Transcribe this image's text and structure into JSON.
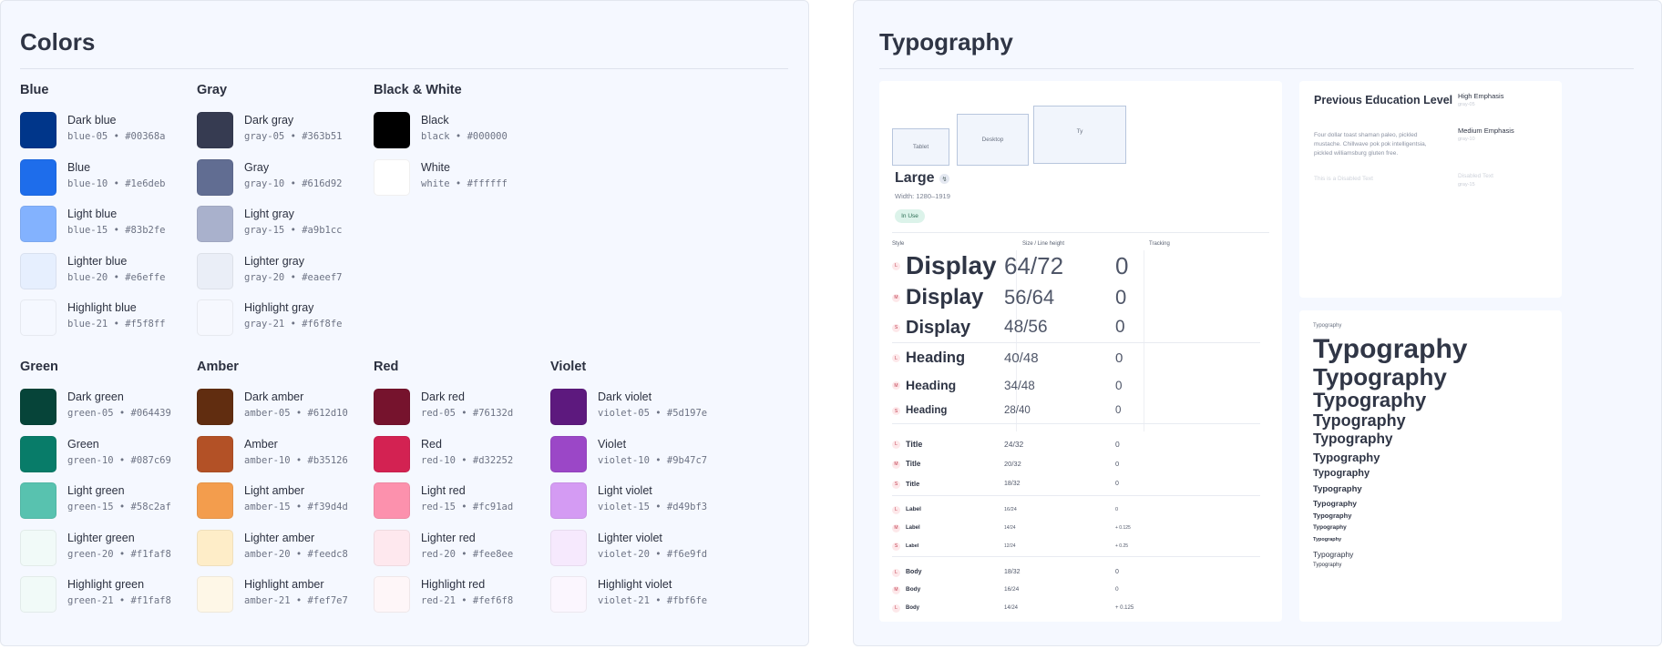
{
  "colors": {
    "title": "Colors",
    "groups": [
      {
        "name": "Blue",
        "swatches": [
          {
            "name": "Dark blue",
            "token": "blue-05",
            "hex": "#00368a"
          },
          {
            "name": "Blue",
            "token": "blue-10",
            "hex": "#1e6deb"
          },
          {
            "name": "Light blue",
            "token": "blue-15",
            "hex": "#83b2fe"
          },
          {
            "name": "Lighter blue",
            "token": "blue-20",
            "hex": "#e6effe"
          },
          {
            "name": "Highlight blue",
            "token": "blue-21",
            "hex": "#f5f8ff"
          }
        ]
      },
      {
        "name": "Gray",
        "swatches": [
          {
            "name": "Dark gray",
            "token": "gray-05",
            "hex": "#363b51"
          },
          {
            "name": "Gray",
            "token": "gray-10",
            "hex": "#616d92"
          },
          {
            "name": "Light gray",
            "token": "gray-15",
            "hex": "#a9b1cc"
          },
          {
            "name": "Lighter gray",
            "token": "gray-20",
            "hex": "#eaeef7"
          },
          {
            "name": "Highlight gray",
            "token": "gray-21",
            "hex": "#f6f8fe"
          }
        ]
      },
      {
        "name": "Black & White",
        "swatches": [
          {
            "name": "Black",
            "token": "black",
            "hex": "#000000"
          },
          {
            "name": "White",
            "token": "white",
            "hex": "#ffffff"
          }
        ]
      },
      {
        "name": "Green",
        "swatches": [
          {
            "name": "Dark green",
            "token": "green-05",
            "hex": "#064439"
          },
          {
            "name": "Green",
            "token": "green-10",
            "hex": "#087c69"
          },
          {
            "name": "Light green",
            "token": "green-15",
            "hex": "#58c2af"
          },
          {
            "name": "Lighter green",
            "token": "green-20",
            "hex": "#f1faf8"
          },
          {
            "name": "Highlight green",
            "token": "green-21",
            "hex": "#f1faf8"
          }
        ]
      },
      {
        "name": "Amber",
        "swatches": [
          {
            "name": "Dark amber",
            "token": "amber-05",
            "hex": "#612d10"
          },
          {
            "name": "Amber",
            "token": "amber-10",
            "hex": "#b35126"
          },
          {
            "name": "Light amber",
            "token": "amber-15",
            "hex": "#f39d4d"
          },
          {
            "name": "Lighter amber",
            "token": "amber-20",
            "hex": "#feedc8"
          },
          {
            "name": "Highlight amber",
            "token": "amber-21",
            "hex": "#fef7e7"
          }
        ]
      },
      {
        "name": "Red",
        "swatches": [
          {
            "name": "Dark red",
            "token": "red-05",
            "hex": "#76132d"
          },
          {
            "name": "Red",
            "token": "red-10",
            "hex": "#d32252"
          },
          {
            "name": "Light red",
            "token": "red-15",
            "hex": "#fc91ad"
          },
          {
            "name": "Lighter red",
            "token": "red-20",
            "hex": "#fee8ee"
          },
          {
            "name": "Highlight red",
            "token": "red-21",
            "hex": "#fef6f8"
          }
        ]
      },
      {
        "name": "Violet",
        "swatches": [
          {
            "name": "Dark violet",
            "token": "violet-05",
            "hex": "#5d197e"
          },
          {
            "name": "Violet",
            "token": "violet-10",
            "hex": "#9b47c7"
          },
          {
            "name": "Light violet",
            "token": "violet-15",
            "hex": "#d49bf3"
          },
          {
            "name": "Lighter violet",
            "token": "violet-20",
            "hex": "#f6e9fd"
          },
          {
            "name": "Highlight violet",
            "token": "violet-21",
            "hex": "#fbf6fe"
          }
        ]
      }
    ]
  },
  "typography": {
    "title": "Typography",
    "breakpoints": [
      "Tablet",
      "Desktop",
      "Ty"
    ],
    "large": {
      "title": "Large",
      "pin": "↯",
      "width": "Width: 1280–1919",
      "badge": "In Use"
    },
    "table": {
      "headers": [
        "Style",
        "Size / Line height",
        "Tracking"
      ],
      "rows": [
        {
          "size_tag": "L",
          "style": "Display",
          "size": "64/72",
          "tracking": "0"
        },
        {
          "size_tag": "M",
          "style": "Display",
          "size": "56/64",
          "tracking": "0"
        },
        {
          "size_tag": "S",
          "style": "Display",
          "size": "48/56",
          "tracking": "0"
        },
        {
          "size_tag": "L",
          "style": "Heading",
          "size": "40/48",
          "tracking": "0"
        },
        {
          "size_tag": "M",
          "style": "Heading",
          "size": "34/48",
          "tracking": "0"
        },
        {
          "size_tag": "S",
          "style": "Heading",
          "size": "28/40",
          "tracking": "0"
        },
        {
          "size_tag": "L",
          "style": "Title",
          "size": "24/32",
          "tracking": "0"
        },
        {
          "size_tag": "M",
          "style": "Title",
          "size": "20/32",
          "tracking": "0"
        },
        {
          "size_tag": "S",
          "style": "Title",
          "size": "18/32",
          "tracking": "0"
        },
        {
          "size_tag": "L",
          "style": "Label",
          "size": "16/24",
          "tracking": "0"
        },
        {
          "size_tag": "M",
          "style": "Label",
          "size": "14/24",
          "tracking": "+ 0.125"
        },
        {
          "size_tag": "S",
          "style": "Label",
          "size": "12/24",
          "tracking": "+ 0.25"
        },
        {
          "size_tag": "L",
          "style": "Body",
          "size": "18/32",
          "tracking": "0"
        },
        {
          "size_tag": "M",
          "style": "Body",
          "size": "16/24",
          "tracking": "0"
        },
        {
          "size_tag": "L",
          "style": "Body",
          "size": "14/24",
          "tracking": "+ 0.125"
        }
      ]
    },
    "education": {
      "title": "Previous Education Level",
      "body": "Four dollar toast shaman paleo, pickled mustache. Chillwave pok pok intelligentsia, pickled williamsburg gluten free.",
      "disabled": "This is a Disabled Text",
      "high_emphasis": "High Emphasis",
      "high_emphasis_sub": "gray-05",
      "medium_emphasis": "Medium  Emphasis",
      "medium_emphasis_sub": "gray-10",
      "disabled_label": "Disabled Text",
      "disabled_sub": "gray-15"
    },
    "scale": {
      "label": "Typography",
      "items": [
        "Typography",
        "Typography",
        "Typography",
        "Typography",
        "Typography",
        "Typography",
        "Typography",
        "Typography",
        "Typography",
        "Typography",
        "Typography",
        "Typography",
        "Typography",
        "Typography"
      ]
    }
  }
}
